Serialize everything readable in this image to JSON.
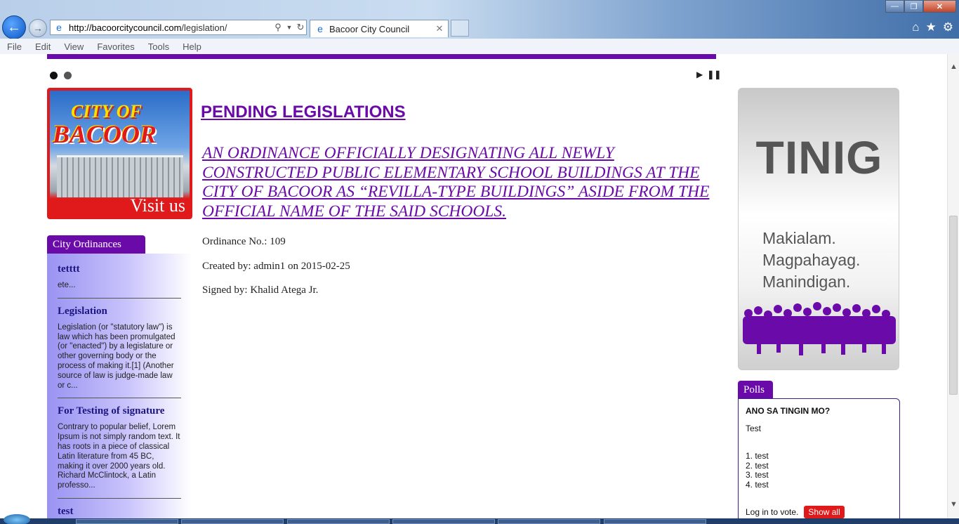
{
  "browser": {
    "url_prefix": "http://bacoorcitycouncil.com",
    "url_path": "/legislation/",
    "tab_title": "Bacoor City Council",
    "menu": [
      "File",
      "Edit",
      "View",
      "Favorites",
      "Tools",
      "Help"
    ]
  },
  "banner": {
    "title_small": "CITY OF",
    "title_big": "BACOOR",
    "visit": "Visit us"
  },
  "ordinances_panel": {
    "tab_label": "City Ordinances",
    "items": [
      {
        "title": "tetttt",
        "excerpt": "ete..."
      },
      {
        "title": "Legislation",
        "excerpt": "Legislation (or \"statutory law\") is law which has been promulgated (or \"enacted\") by a legislature or other governing body or the process of making it.[1] (Another source of law is judge-made law or c..."
      },
      {
        "title": "For Testing of signature",
        "excerpt": "Contrary to popular belief, Lorem Ipsum is not simply random text. It has roots in a piece of classical Latin literature from 45 BC, making it over 2000 years old. Richard McClintock, a Latin professo..."
      },
      {
        "title": "test",
        "excerpt": ""
      }
    ]
  },
  "main": {
    "heading": "PENDING LEGISLATIONS",
    "ordinance_title": "AN ORDINANCE OFFICIALLY DESIGNATING ALL NEWLY CONSTRUCTED PUBLIC ELEMENTARY SCHOOL BUILDINGS AT THE CITY OF BACOOR AS “REVILLA-TYPE BUILDINGS” ASIDE FROM THE OFFICIAL NAME OF THE SAID SCHOOLS.",
    "ordinance_no": "Ordinance No.: 109",
    "created_by": "Created by: admin1 on 2015-02-25",
    "signed_by": "Signed by: Khalid Atega Jr."
  },
  "tinig": {
    "word": "TINIG",
    "line1": "Makialam.",
    "line2": "Magpahayag.",
    "line3": "Manindigan."
  },
  "polls": {
    "tab_label": "Polls",
    "question": "ANO SA TINGIN MO?",
    "description": "Test",
    "options": [
      "1. test",
      "2. test",
      "3. test",
      "4. test"
    ],
    "login_text": "Log in to vote.",
    "show_all": "Show all"
  },
  "colors": {
    "accent_purple": "#6a0aa8",
    "banner_red": "#e0191a",
    "ordinance_heading": "#1c1480"
  }
}
